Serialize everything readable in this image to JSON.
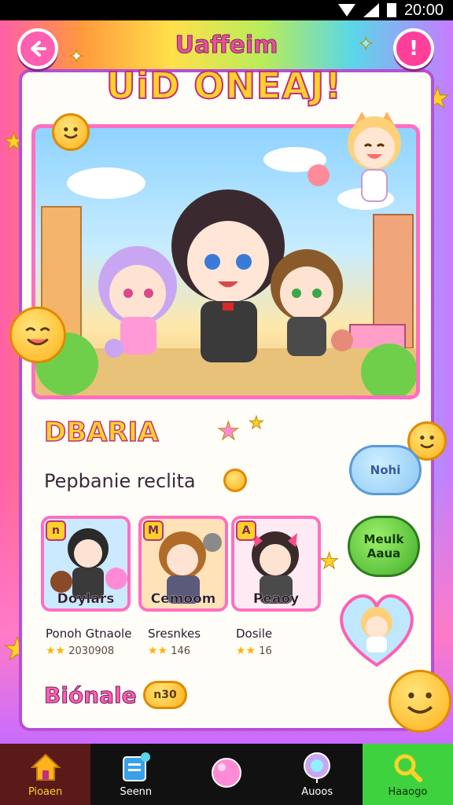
{
  "status_bar": {
    "time": "20:00"
  },
  "header": {
    "title_small": "Uaffeim",
    "title_big": "UiD ONEAJ!"
  },
  "buttons": {
    "back_icon": "arrow-left-icon",
    "info_label": "!"
  },
  "section": {
    "title": "DBARIA",
    "subtitle": "Pepbanie reclita"
  },
  "characters": [
    {
      "tag": "n",
      "name": "Doylars",
      "label": "Ponoh Gtnaole",
      "stars": "★★",
      "rating": "2030908"
    },
    {
      "tag": "M",
      "name": "Cemoom",
      "label": "Sresnkes",
      "stars": "★★",
      "rating": "146"
    },
    {
      "tag": "A",
      "name": "Peaoy",
      "label": "Dosile",
      "stars": "★★",
      "rating": "16"
    }
  ],
  "side_buttons": {
    "blue_label": "Nohi",
    "green_line1": "Meulk",
    "green_line2": "Aaua"
  },
  "bottom": {
    "title": "Biónale",
    "badge": "n30"
  },
  "nav": [
    {
      "label": "Pioaen",
      "icon": "home-icon"
    },
    {
      "label": "Seenn",
      "icon": "card-icon"
    },
    {
      "label": "",
      "icon": "pink-orb-icon"
    },
    {
      "label": "Auoos",
      "icon": "balloon-icon"
    },
    {
      "label": "Haaogo",
      "icon": "search-icon"
    }
  ],
  "colors": {
    "accent_pink": "#ff5fb0",
    "accent_yellow": "#ffd12a",
    "card_border": "#b64fd6",
    "active_green": "#3ed33e"
  }
}
